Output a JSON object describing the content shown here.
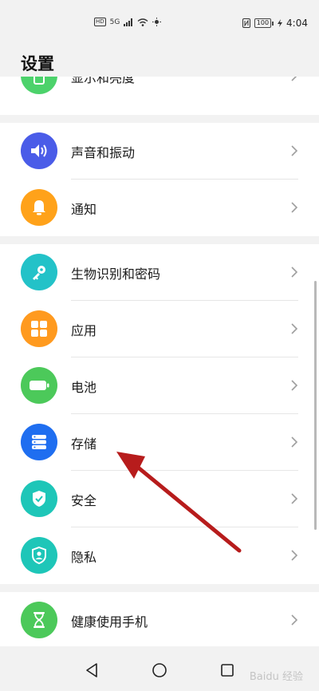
{
  "status_bar": {
    "hd": "HD",
    "network": "5G",
    "battery_level": "100",
    "time": "4:04"
  },
  "page_title": "设置",
  "items": [
    {
      "label": "显示和亮度",
      "icon": "phone-display-icon",
      "color": "#4cd26b"
    },
    {
      "label": "声音和振动",
      "icon": "speaker-icon",
      "color": "#4a5ce8"
    },
    {
      "label": "通知",
      "icon": "bell-icon",
      "color": "#ffa21a"
    },
    {
      "label": "生物识别和密码",
      "icon": "key-icon",
      "color": "#23c2c8"
    },
    {
      "label": "应用",
      "icon": "apps-grid-icon",
      "color": "#ff9a1f"
    },
    {
      "label": "电池",
      "icon": "battery-icon",
      "color": "#4cc95a"
    },
    {
      "label": "存储",
      "icon": "storage-icon",
      "color": "#1f6ef0"
    },
    {
      "label": "安全",
      "icon": "shield-check-icon",
      "color": "#1ec6b8"
    },
    {
      "label": "隐私",
      "icon": "privacy-shield-icon",
      "color": "#1ec6b8"
    },
    {
      "label": "健康使用手机",
      "icon": "hourglass-icon",
      "color": "#4cc95a"
    }
  ],
  "annotation": {
    "type": "arrow",
    "color": "#b71c1c",
    "points_to": "存储"
  },
  "watermark": "Baidu 经验"
}
